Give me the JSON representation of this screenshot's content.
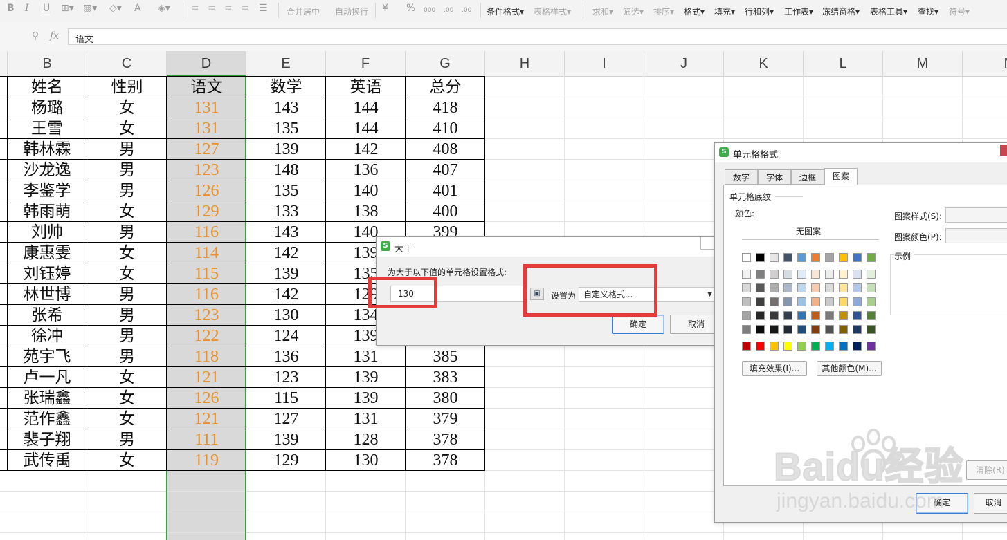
{
  "toolbar": {
    "merge_center": "合并居中",
    "auto_wrap": "自动换行",
    "conditional_format": "条件格式",
    "table_style": "表格样式",
    "sum": "求和",
    "filter": "筛选",
    "sort": "排序",
    "format": "格式",
    "fill": "填充",
    "row_col": "行和列",
    "worksheet": "工作表",
    "freeze": "冻结窗格",
    "table_tools": "表格工具",
    "find": "查找",
    "symbol": "符号",
    "bold": "B",
    "italic": "I",
    "underline": "U",
    "percent": "%",
    "font_color": "A",
    "inc_decimal": ".00",
    "dec_decimal": ".00",
    "thousands": "000",
    "currency": "¥"
  },
  "formula_bar": {
    "fx": "fx",
    "value": "语文"
  },
  "columns": [
    "B",
    "C",
    "D",
    "E",
    "F",
    "G",
    "H",
    "I",
    "J",
    "K",
    "L",
    "M",
    "N"
  ],
  "table": {
    "headers": [
      "姓名",
      "性别",
      "语文",
      "数学",
      "英语",
      "总分"
    ],
    "rows": [
      [
        "杨璐",
        "女",
        "131",
        "143",
        "144",
        "418"
      ],
      [
        "王雪",
        "女",
        "131",
        "135",
        "144",
        "410"
      ],
      [
        "韩林霖",
        "男",
        "127",
        "139",
        "142",
        "408"
      ],
      [
        "沙龙逸",
        "男",
        "123",
        "148",
        "136",
        "407"
      ],
      [
        "李鉴学",
        "男",
        "126",
        "135",
        "140",
        "401"
      ],
      [
        "韩雨萌",
        "女",
        "129",
        "133",
        "138",
        "400"
      ],
      [
        "刘帅",
        "男",
        "116",
        "143",
        "140",
        "399"
      ],
      [
        "康惠雯",
        "女",
        "114",
        "142",
        "139",
        ""
      ],
      [
        "刘钰婷",
        "女",
        "115",
        "139",
        "135",
        ""
      ],
      [
        "林世博",
        "男",
        "116",
        "142",
        "129",
        ""
      ],
      [
        "张希",
        "男",
        "123",
        "130",
        "134",
        ""
      ],
      [
        "徐冲",
        "男",
        "122",
        "124",
        "139",
        ""
      ],
      [
        "苑宇飞",
        "男",
        "118",
        "136",
        "131",
        "385"
      ],
      [
        "卢一凡",
        "女",
        "121",
        "123",
        "139",
        "383"
      ],
      [
        "张瑞鑫",
        "女",
        "126",
        "115",
        "139",
        "380"
      ],
      [
        "范作鑫",
        "女",
        "121",
        "127",
        "131",
        "379"
      ],
      [
        "裴子翔",
        "男",
        "111",
        "139",
        "128",
        "378"
      ],
      [
        "武传禹",
        "女",
        "119",
        "129",
        "130",
        "378"
      ]
    ]
  },
  "dialog_gt": {
    "title": "大于",
    "prompt": "为大于以下值的单元格设置格式:",
    "value": "130",
    "set_as_label": "设置为",
    "format_value": "自定义格式...",
    "ok": "确定",
    "cancel": "取消"
  },
  "dialog_format": {
    "title": "单元格格式",
    "tabs": [
      "数字",
      "字体",
      "边框",
      "图案"
    ],
    "active_tab": "图案",
    "group_label": "单元格底纹",
    "color_label": "颜色:",
    "no_pattern": "无图案",
    "pattern_style_label": "图案样式(S):",
    "pattern_color_label": "图案颜色(P):",
    "example_label": "示例",
    "fill_effects": "填充效果(I)...",
    "more_colors": "其他颜色(M)...",
    "clear": "清除(R)",
    "ok": "确定",
    "cancel": "取消"
  },
  "palette": {
    "row1": [
      "#ffffff",
      "#000000",
      "#e7e6e6",
      "#44546a",
      "#5b9bd5",
      "#ed7d31",
      "#a5a5a5",
      "#ffc000",
      "#4472c4",
      "#70ad47"
    ],
    "row2": [
      "#f2f2f2",
      "#7f7f7f",
      "#d0cece",
      "#d6dce4",
      "#deebf6",
      "#fbe5d5",
      "#ededed",
      "#fff2cc",
      "#d9e2f3",
      "#e2efd9"
    ],
    "row3": [
      "#d8d8d8",
      "#595959",
      "#aeabab",
      "#adb9ca",
      "#bdd7ee",
      "#f7cbac",
      "#dbdbdb",
      "#fee599",
      "#b4c6e7",
      "#c5e0b3"
    ],
    "row4": [
      "#bfbfbf",
      "#3f3f3f",
      "#757070",
      "#8496b0",
      "#9cc3e5",
      "#f4b183",
      "#c9c9c9",
      "#ffd965",
      "#8eaadb",
      "#a8d08d"
    ],
    "row5": [
      "#a5a5a5",
      "#262626",
      "#3a3838",
      "#323f4f",
      "#2e75b5",
      "#c55a11",
      "#7b7b7b",
      "#bf9000",
      "#2f5496",
      "#538135"
    ],
    "row6": [
      "#7f7f7f",
      "#0c0c0c",
      "#171616",
      "#222a35",
      "#1e4e79",
      "#833c0b",
      "#525252",
      "#7f6000",
      "#1f3864",
      "#375623"
    ],
    "standard": [
      "#c00000",
      "#ff0000",
      "#ffc000",
      "#ffff00",
      "#92d050",
      "#00b050",
      "#00b0f0",
      "#0070c0",
      "#002060",
      "#7030a0"
    ]
  },
  "watermark": {
    "brand": "Baidu经验",
    "sub": "jingyan.baidu.com"
  }
}
